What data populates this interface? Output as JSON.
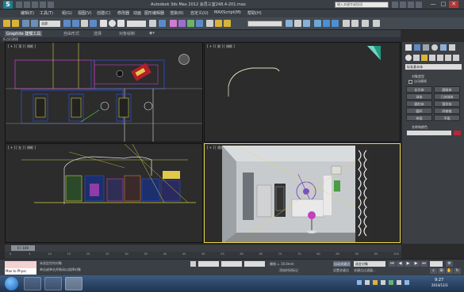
{
  "window": {
    "logo": "S",
    "title": "Autodesk 3ds Max 2012    会员三室248.4-201.max",
    "search_placeholder": "输入关键字或短语",
    "min": "—",
    "max": "□",
    "close": "✕"
  },
  "menu": [
    "编辑(E)",
    "工具(T)",
    "组(G)",
    "视图(V)",
    "创建(C)",
    "修改器",
    "动画",
    "图形编辑器",
    "渲染(R)",
    "自定义(U)",
    "MAXScript(M)",
    "帮助(H)"
  ],
  "toolbar": {
    "selection_filter": "全部",
    "named_selection": ""
  },
  "ribbon": {
    "tabs": [
      "Graphite 建模工具",
      "自由形式",
      "选择",
      "对象绘制",
      "◉▾"
    ],
    "sub": "多边形建模"
  },
  "viewports": {
    "top": "[ + ] [ 顶 ] [ 线框 ]",
    "front": "[ + ] [ 前 ] [ 线框 ]",
    "left": "[ + ] [ 左 ] [ 线框 ]",
    "perspective": "[ + ] [ 透视 ] [ 真实 ]"
  },
  "command_panel": {
    "category": "标准基本体",
    "rollout_object_type": "对象类型",
    "autogrid": "自动栅格",
    "buttons": [
      "长方体",
      "圆锥体",
      "球体",
      "几何球体",
      "圆柱体",
      "管状体",
      "圆环",
      "四棱锥",
      "茶壶",
      "平面"
    ],
    "rollout_name_color": "名称和颜色"
  },
  "timeline": {
    "slider": "0 / 100",
    "ticks": [
      "0",
      "5",
      "10",
      "15",
      "20",
      "25",
      "30",
      "35",
      "40",
      "45",
      "50",
      "55",
      "60",
      "65",
      "70",
      "75",
      "80",
      "85",
      "90",
      "95",
      "100"
    ]
  },
  "status": {
    "maxscript_input": "Max to Physc",
    "line1": "未选定任何对象",
    "line2": "单击或单击并拖动以选择对象",
    "grid": "栅格 = 10.0mm",
    "add_time_tag": "添加时间标记",
    "auto_key": "自动关键点",
    "selection_set": "选定对象",
    "set_key": "设置关键点",
    "key_filters": "关键点过滤器..."
  },
  "taskbar": {
    "time": "9:27",
    "date": "2014/12/3"
  },
  "colors": {
    "accent_yellow": "#e8d24a",
    "wire_magenta": "#c040c0",
    "wire_blue": "#3050d0",
    "panel": "#3c3f44"
  }
}
